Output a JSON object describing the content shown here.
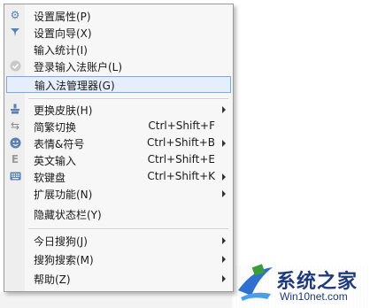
{
  "menu": {
    "items": [
      {
        "label": "设置属性(P)",
        "icon": "gear-icon"
      },
      {
        "label": "设置向导(X)",
        "icon": "wand-icon"
      },
      {
        "label": "输入统计(I)"
      },
      {
        "label": "登录输入法账户(L)",
        "icon": "check-circle-icon"
      },
      {
        "label": "输入法管理器(G)",
        "highlighted": true
      },
      {
        "label": "更换皮肤(H)",
        "icon": "brush-icon",
        "submenu": true
      },
      {
        "label": "简繁切换",
        "shortcut": "Ctrl+Shift+F",
        "icon": "switch-icon"
      },
      {
        "label": "表情&符号",
        "shortcut": "Ctrl+Shift+B",
        "icon": "smiley-icon",
        "submenu": true
      },
      {
        "label": "英文输入",
        "shortcut": "Ctrl+Shift+E",
        "icon": "letter-e-icon"
      },
      {
        "label": "软键盘",
        "shortcut": "Ctrl+Shift+K",
        "icon": "keyboard-icon",
        "submenu": true
      },
      {
        "label": "扩展功能(N)",
        "submenu": true
      },
      {
        "label": "隐藏状态栏(Y)"
      },
      {
        "label": "今日搜狗(J)",
        "submenu": true
      },
      {
        "label": "搜狗搜索(M)",
        "submenu": true
      },
      {
        "label": "帮助(Z)",
        "submenu": true
      }
    ]
  },
  "watermark": {
    "name": "系统之家",
    "site": "Win10net.com"
  },
  "colors": {
    "highlight_bg": "#e5eefa",
    "highlight_border": "#86a8d6",
    "icon_blue": "#5a7fb0"
  }
}
